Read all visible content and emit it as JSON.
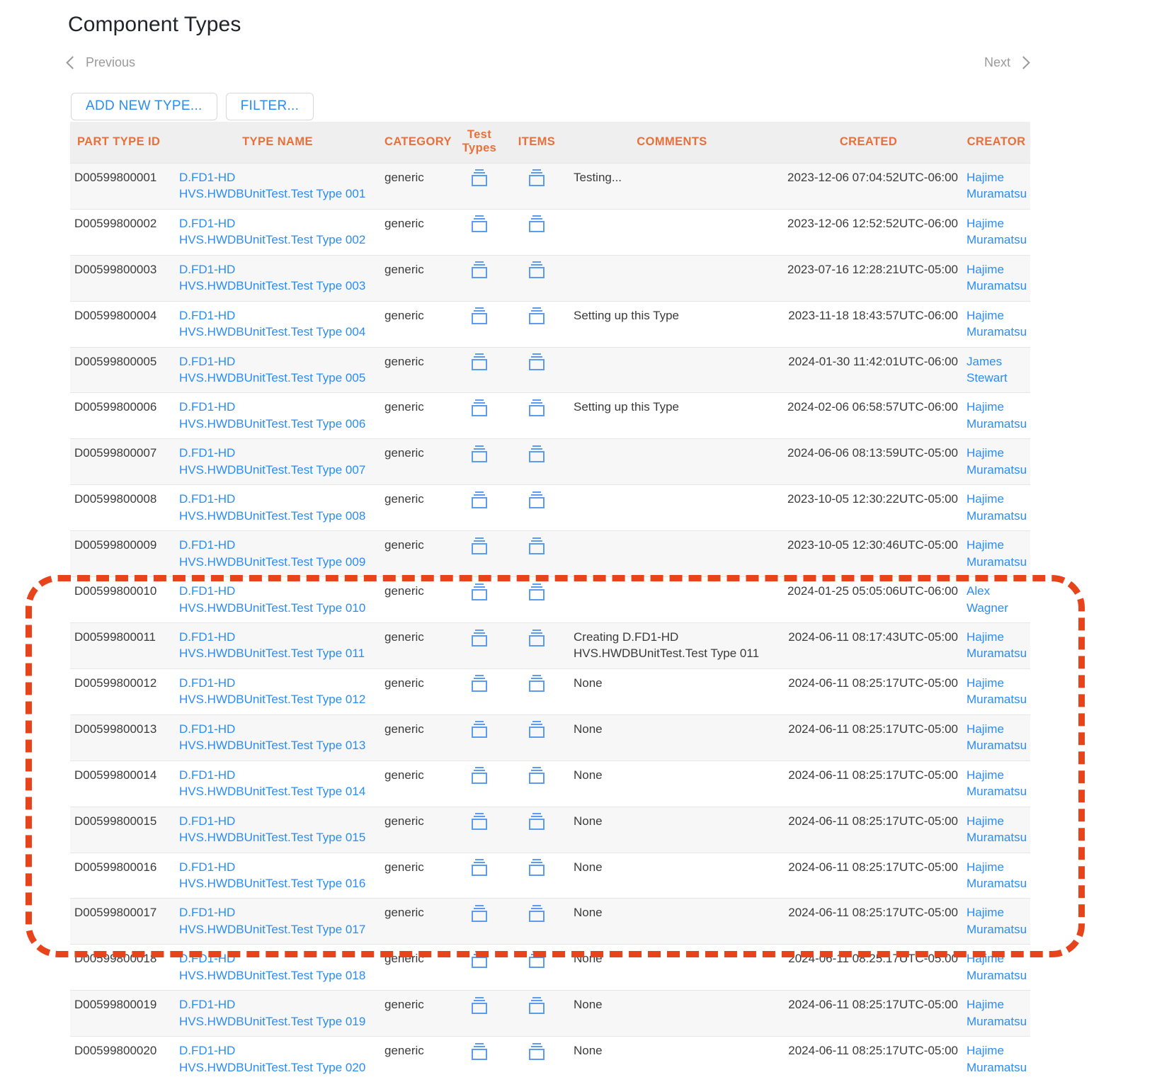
{
  "header": {
    "title": "Component Types"
  },
  "pager": {
    "previous_label": "Previous",
    "next_label": "Next",
    "prev_icon": "chevron-left-icon",
    "next_icon": "chevron-right-icon"
  },
  "toolbar": {
    "add_new_type_label": "ADD NEW TYPE...",
    "filter_label": "FILTER..."
  },
  "table": {
    "columns": [
      "PART TYPE ID",
      "TYPE NAME",
      "CATEGORY",
      "Test Types",
      "ITEMS",
      "COMMENTS",
      "CREATED",
      "CREATOR"
    ],
    "test_types_header_line1": "Test",
    "test_types_header_line2": "Types",
    "icon_name": "archive-box-icon",
    "rows": [
      {
        "part_type_id": "D00599800001",
        "type_name_line1": "D.FD1-HD",
        "type_name_line2": "HVS.HWDBUnitTest.Test Type 001",
        "category": "generic",
        "comments": "Testing...",
        "comments_line2": "",
        "created": "2023-12-06 07:04:52UTC-06:00",
        "creator_line1": "Hajime",
        "creator_line2": "Muramatsu"
      },
      {
        "part_type_id": "D00599800002",
        "type_name_line1": "D.FD1-HD",
        "type_name_line2": "HVS.HWDBUnitTest.Test Type 002",
        "category": "generic",
        "comments": "",
        "comments_line2": "",
        "created": "2023-12-06 12:52:52UTC-06:00",
        "creator_line1": "Hajime",
        "creator_line2": "Muramatsu"
      },
      {
        "part_type_id": "D00599800003",
        "type_name_line1": "D.FD1-HD",
        "type_name_line2": "HVS.HWDBUnitTest.Test Type 003",
        "category": "generic",
        "comments": "",
        "comments_line2": "",
        "created": "2023-07-16 12:28:21UTC-05:00",
        "creator_line1": "Hajime",
        "creator_line2": "Muramatsu"
      },
      {
        "part_type_id": "D00599800004",
        "type_name_line1": "D.FD1-HD",
        "type_name_line2": "HVS.HWDBUnitTest.Test Type 004",
        "category": "generic",
        "comments": "Setting up this Type",
        "comments_line2": "",
        "created": "2023-11-18 18:43:57UTC-06:00",
        "creator_line1": "Hajime",
        "creator_line2": "Muramatsu"
      },
      {
        "part_type_id": "D00599800005",
        "type_name_line1": "D.FD1-HD",
        "type_name_line2": "HVS.HWDBUnitTest.Test Type 005",
        "category": "generic",
        "comments": "",
        "comments_line2": "",
        "created": "2024-01-30 11:42:01UTC-06:00",
        "creator_line1": "James",
        "creator_line2": "Stewart"
      },
      {
        "part_type_id": "D00599800006",
        "type_name_line1": "D.FD1-HD",
        "type_name_line2": "HVS.HWDBUnitTest.Test Type 006",
        "category": "generic",
        "comments": "Setting up this Type",
        "comments_line2": "",
        "created": "2024-02-06 06:58:57UTC-06:00",
        "creator_line1": "Hajime",
        "creator_line2": "Muramatsu"
      },
      {
        "part_type_id": "D00599800007",
        "type_name_line1": "D.FD1-HD",
        "type_name_line2": "HVS.HWDBUnitTest.Test Type 007",
        "category": "generic",
        "comments": "",
        "comments_line2": "",
        "created": "2024-06-06 08:13:59UTC-05:00",
        "creator_line1": "Hajime",
        "creator_line2": "Muramatsu"
      },
      {
        "part_type_id": "D00599800008",
        "type_name_line1": "D.FD1-HD",
        "type_name_line2": "HVS.HWDBUnitTest.Test Type 008",
        "category": "generic",
        "comments": "",
        "comments_line2": "",
        "created": "2023-10-05 12:30:22UTC-05:00",
        "creator_line1": "Hajime",
        "creator_line2": "Muramatsu"
      },
      {
        "part_type_id": "D00599800009",
        "type_name_line1": "D.FD1-HD",
        "type_name_line2": "HVS.HWDBUnitTest.Test Type 009",
        "category": "generic",
        "comments": "",
        "comments_line2": "",
        "created": "2023-10-05 12:30:46UTC-05:00",
        "creator_line1": "Hajime",
        "creator_line2": "Muramatsu"
      },
      {
        "part_type_id": "D00599800010",
        "type_name_line1": "D.FD1-HD",
        "type_name_line2": "HVS.HWDBUnitTest.Test Type 010",
        "category": "generic",
        "comments": "",
        "comments_line2": "",
        "created": "2024-01-25 05:05:06UTC-06:00",
        "creator_line1": "Alex",
        "creator_line2": "Wagner"
      },
      {
        "part_type_id": "D00599800011",
        "type_name_line1": "D.FD1-HD",
        "type_name_line2": "HVS.HWDBUnitTest.Test Type 011",
        "category": "generic",
        "comments": "Creating D.FD1-HD",
        "comments_line2": "HVS.HWDBUnitTest.Test Type 011",
        "created": "2024-06-11 08:17:43UTC-05:00",
        "creator_line1": "Hajime",
        "creator_line2": "Muramatsu"
      },
      {
        "part_type_id": "D00599800012",
        "type_name_line1": "D.FD1-HD",
        "type_name_line2": "HVS.HWDBUnitTest.Test Type 012",
        "category": "generic",
        "comments": "None",
        "comments_line2": "",
        "created": "2024-06-11 08:25:17UTC-05:00",
        "creator_line1": "Hajime",
        "creator_line2": "Muramatsu"
      },
      {
        "part_type_id": "D00599800013",
        "type_name_line1": "D.FD1-HD",
        "type_name_line2": "HVS.HWDBUnitTest.Test Type 013",
        "category": "generic",
        "comments": "None",
        "comments_line2": "",
        "created": "2024-06-11 08:25:17UTC-05:00",
        "creator_line1": "Hajime",
        "creator_line2": "Muramatsu"
      },
      {
        "part_type_id": "D00599800014",
        "type_name_line1": "D.FD1-HD",
        "type_name_line2": "HVS.HWDBUnitTest.Test Type 014",
        "category": "generic",
        "comments": "None",
        "comments_line2": "",
        "created": "2024-06-11 08:25:17UTC-05:00",
        "creator_line1": "Hajime",
        "creator_line2": "Muramatsu"
      },
      {
        "part_type_id": "D00599800015",
        "type_name_line1": "D.FD1-HD",
        "type_name_line2": "HVS.HWDBUnitTest.Test Type 015",
        "category": "generic",
        "comments": "None",
        "comments_line2": "",
        "created": "2024-06-11 08:25:17UTC-05:00",
        "creator_line1": "Hajime",
        "creator_line2": "Muramatsu"
      },
      {
        "part_type_id": "D00599800016",
        "type_name_line1": "D.FD1-HD",
        "type_name_line2": "HVS.HWDBUnitTest.Test Type 016",
        "category": "generic",
        "comments": "None",
        "comments_line2": "",
        "created": "2024-06-11 08:25:17UTC-05:00",
        "creator_line1": "Hajime",
        "creator_line2": "Muramatsu"
      },
      {
        "part_type_id": "D00599800017",
        "type_name_line1": "D.FD1-HD",
        "type_name_line2": "HVS.HWDBUnitTest.Test Type 017",
        "category": "generic",
        "comments": "None",
        "comments_line2": "",
        "created": "2024-06-11 08:25:17UTC-05:00",
        "creator_line1": "Hajime",
        "creator_line2": "Muramatsu"
      },
      {
        "part_type_id": "D00599800018",
        "type_name_line1": "D.FD1-HD",
        "type_name_line2": "HVS.HWDBUnitTest.Test Type 018",
        "category": "generic",
        "comments": "None",
        "comments_line2": "",
        "created": "2024-06-11 08:25:17UTC-05:00",
        "creator_line1": "Hajime",
        "creator_line2": "Muramatsu"
      },
      {
        "part_type_id": "D00599800019",
        "type_name_line1": "D.FD1-HD",
        "type_name_line2": "HVS.HWDBUnitTest.Test Type 019",
        "category": "generic",
        "comments": "None",
        "comments_line2": "",
        "created": "2024-06-11 08:25:17UTC-05:00",
        "creator_line1": "Hajime",
        "creator_line2": "Muramatsu"
      },
      {
        "part_type_id": "D00599800020",
        "type_name_line1": "D.FD1-HD",
        "type_name_line2": "HVS.HWDBUnitTest.Test Type 020",
        "category": "generic",
        "comments": "None",
        "comments_line2": "",
        "created": "2024-06-11 08:25:17UTC-05:00",
        "creator_line1": "Hajime",
        "creator_line2": "Muramatsu"
      }
    ]
  },
  "annotation": {
    "name": "red-dashed-highlight",
    "color": "#e8441c",
    "style": "dashed-rounded-rectangle"
  },
  "colors": {
    "header_text": "#e8703a",
    "link": "#2a8cf5",
    "header_bg": "#efefef",
    "row_alt_bg": "#f7f7f7",
    "annotation": "#e8441c"
  }
}
